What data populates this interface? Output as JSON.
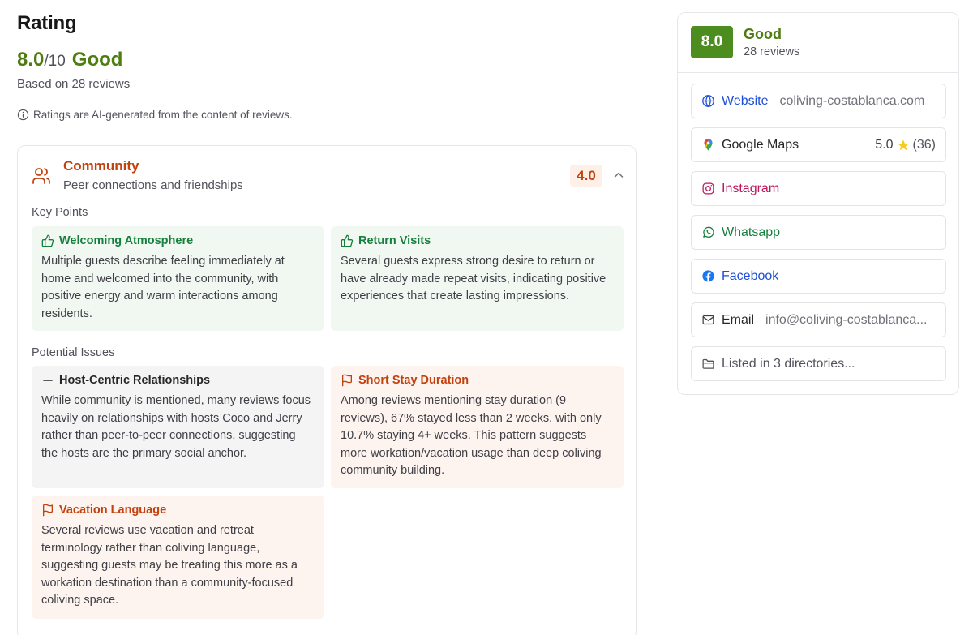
{
  "rating": {
    "heading": "Rating",
    "score": "8.0",
    "out_of": "/10",
    "word": "Good",
    "based_on": "Based on 28 reviews",
    "ai_note": "Ratings are AI-generated from the content of reviews."
  },
  "category": {
    "title": "Community",
    "subtitle": "Peer connections and friendships",
    "score": "4.0",
    "key_points_label": "Key Points",
    "key_points": [
      {
        "title": "Welcoming Atmosphere",
        "body": "Multiple guests describe feeling immediately at home and welcomed into the community, with positive energy and warm interactions among residents."
      },
      {
        "title": "Return Visits",
        "body": "Several guests express strong desire to return or have already made repeat visits, indicating positive experiences that create lasting impressions."
      }
    ],
    "issues_label": "Potential Issues",
    "issues": [
      {
        "title": "Host-Centric Relationships",
        "body": "While community is mentioned, many reviews focus heavily on relationships with hosts Coco and Jerry rather than peer-to-peer connections, suggesting the hosts are the primary social anchor."
      },
      {
        "title": "Short Stay Duration",
        "body": "Among reviews mentioning stay duration (9 reviews), 67% stayed less than 2 weeks, with only 10.7% staying 4+ weeks. This pattern suggests more workation/vacation usage than deep coliving community building."
      },
      {
        "title": "Vacation Language",
        "body": "Several reviews use vacation and retreat terminology rather than coliving language, suggesting guests may be treating this more as a workation destination than a community-focused coliving space."
      }
    ]
  },
  "sidebar": {
    "score": "8.0",
    "word": "Good",
    "reviews": "28 reviews",
    "links": {
      "website": {
        "label": "Website",
        "value": "coliving-costablanca.com"
      },
      "google_maps": {
        "label": "Google Maps",
        "rating": "5.0",
        "count": "(36)"
      },
      "instagram": {
        "label": "Instagram"
      },
      "whatsapp": {
        "label": "Whatsapp"
      },
      "facebook": {
        "label": "Facebook"
      },
      "email": {
        "label": "Email",
        "value": "info@coliving-costablanca..."
      },
      "directories": {
        "label": "Listed in 3 directories..."
      }
    }
  },
  "colors": {
    "good_green": "#4d7c0f",
    "badge_green": "#4d8c1e",
    "issue_orange": "#c2410c",
    "positive_green": "#15803d"
  },
  "icons": [
    "info-icon",
    "users-icon",
    "chevron-up-icon",
    "thumbs-up-icon",
    "minus-icon",
    "flag-icon",
    "globe-icon",
    "map-pin-icon",
    "star-icon",
    "instagram-icon",
    "whatsapp-icon",
    "facebook-icon",
    "mail-icon",
    "folder-icon"
  ]
}
